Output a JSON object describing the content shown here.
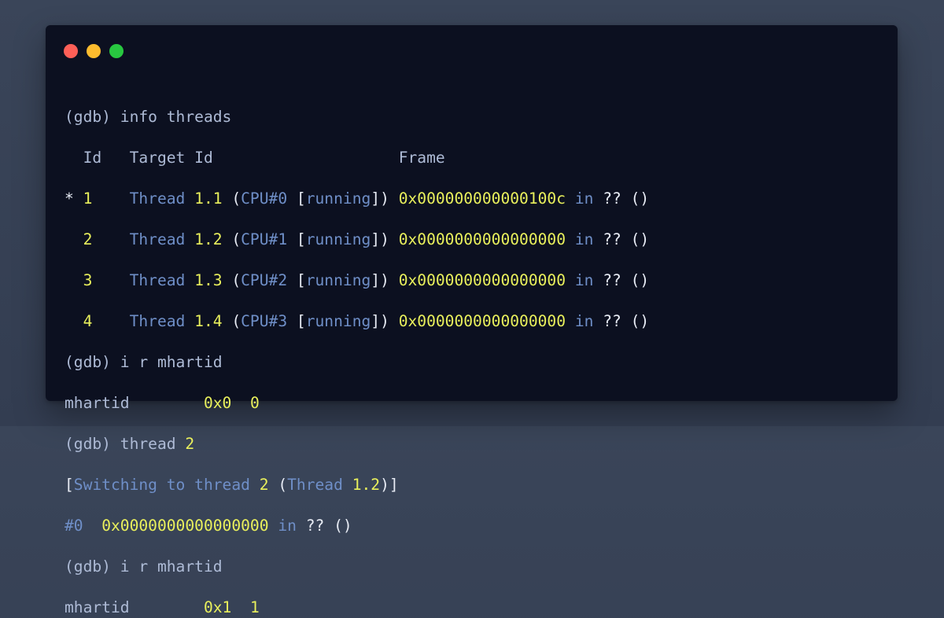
{
  "window": {
    "controls": [
      "close",
      "minimize",
      "maximize"
    ],
    "colors": {
      "close": "#fe5f57",
      "minimize": "#fdbc2e",
      "maximize": "#28c840",
      "background": "#0c1020",
      "yellow_text": "#e9f05c",
      "blue_text": "#6f8fc8"
    }
  },
  "terminal": {
    "l1": {
      "prompt": "(gdb)",
      "cmd": "info threads"
    },
    "l2": {
      "col_id": "Id",
      "col_target": "Target Id",
      "col_frame": "Frame"
    },
    "l3": {
      "marker": "*",
      "id": "1",
      "thread": "Thread",
      "tid": "1.1",
      "p1": "(",
      "cpu": "CPU#0",
      "b1": "[",
      "state": "running",
      "b2": "])",
      "addr": "0x000000000000100c",
      "in": "in",
      "func": "??",
      "parens": "()"
    },
    "l4": {
      "id": "2",
      "thread": "Thread",
      "tid": "1.2",
      "p1": "(",
      "cpu": "CPU#1",
      "b1": "[",
      "state": "running",
      "b2": "])",
      "addr": "0x0000000000000000",
      "in": "in",
      "func": "??",
      "parens": "()"
    },
    "l5": {
      "id": "3",
      "thread": "Thread",
      "tid": "1.3",
      "p1": "(",
      "cpu": "CPU#2",
      "b1": "[",
      "state": "running",
      "b2": "])",
      "addr": "0x0000000000000000",
      "in": "in",
      "func": "??",
      "parens": "()"
    },
    "l6": {
      "id": "4",
      "thread": "Thread",
      "tid": "1.4",
      "p1": "(",
      "cpu": "CPU#3",
      "b1": "[",
      "state": "running",
      "b2": "])",
      "addr": "0x0000000000000000",
      "in": "in",
      "func": "??",
      "parens": "()"
    },
    "l7": {
      "prompt": "(gdb)",
      "cmd": "i r mhartid"
    },
    "l8": {
      "reg": "mhartid",
      "hex": "0x0",
      "dec": "0"
    },
    "l9": {
      "prompt": "(gdb)",
      "cmd": "thread",
      "arg": "2"
    },
    "l10": {
      "b1": "[",
      "text": "Switching to thread",
      "num": "2",
      "p1": "(",
      "thread": "Thread",
      "tid": "1.2",
      "end": ")]"
    },
    "l11": {
      "frame": "#0",
      "addr": "0x0000000000000000",
      "in": "in",
      "func": "??",
      "parens": "()"
    },
    "l12": {
      "prompt": "(gdb)",
      "cmd": "i r mhartid"
    },
    "l13": {
      "reg": "mhartid",
      "hex": "0x1",
      "dec": "1"
    }
  }
}
